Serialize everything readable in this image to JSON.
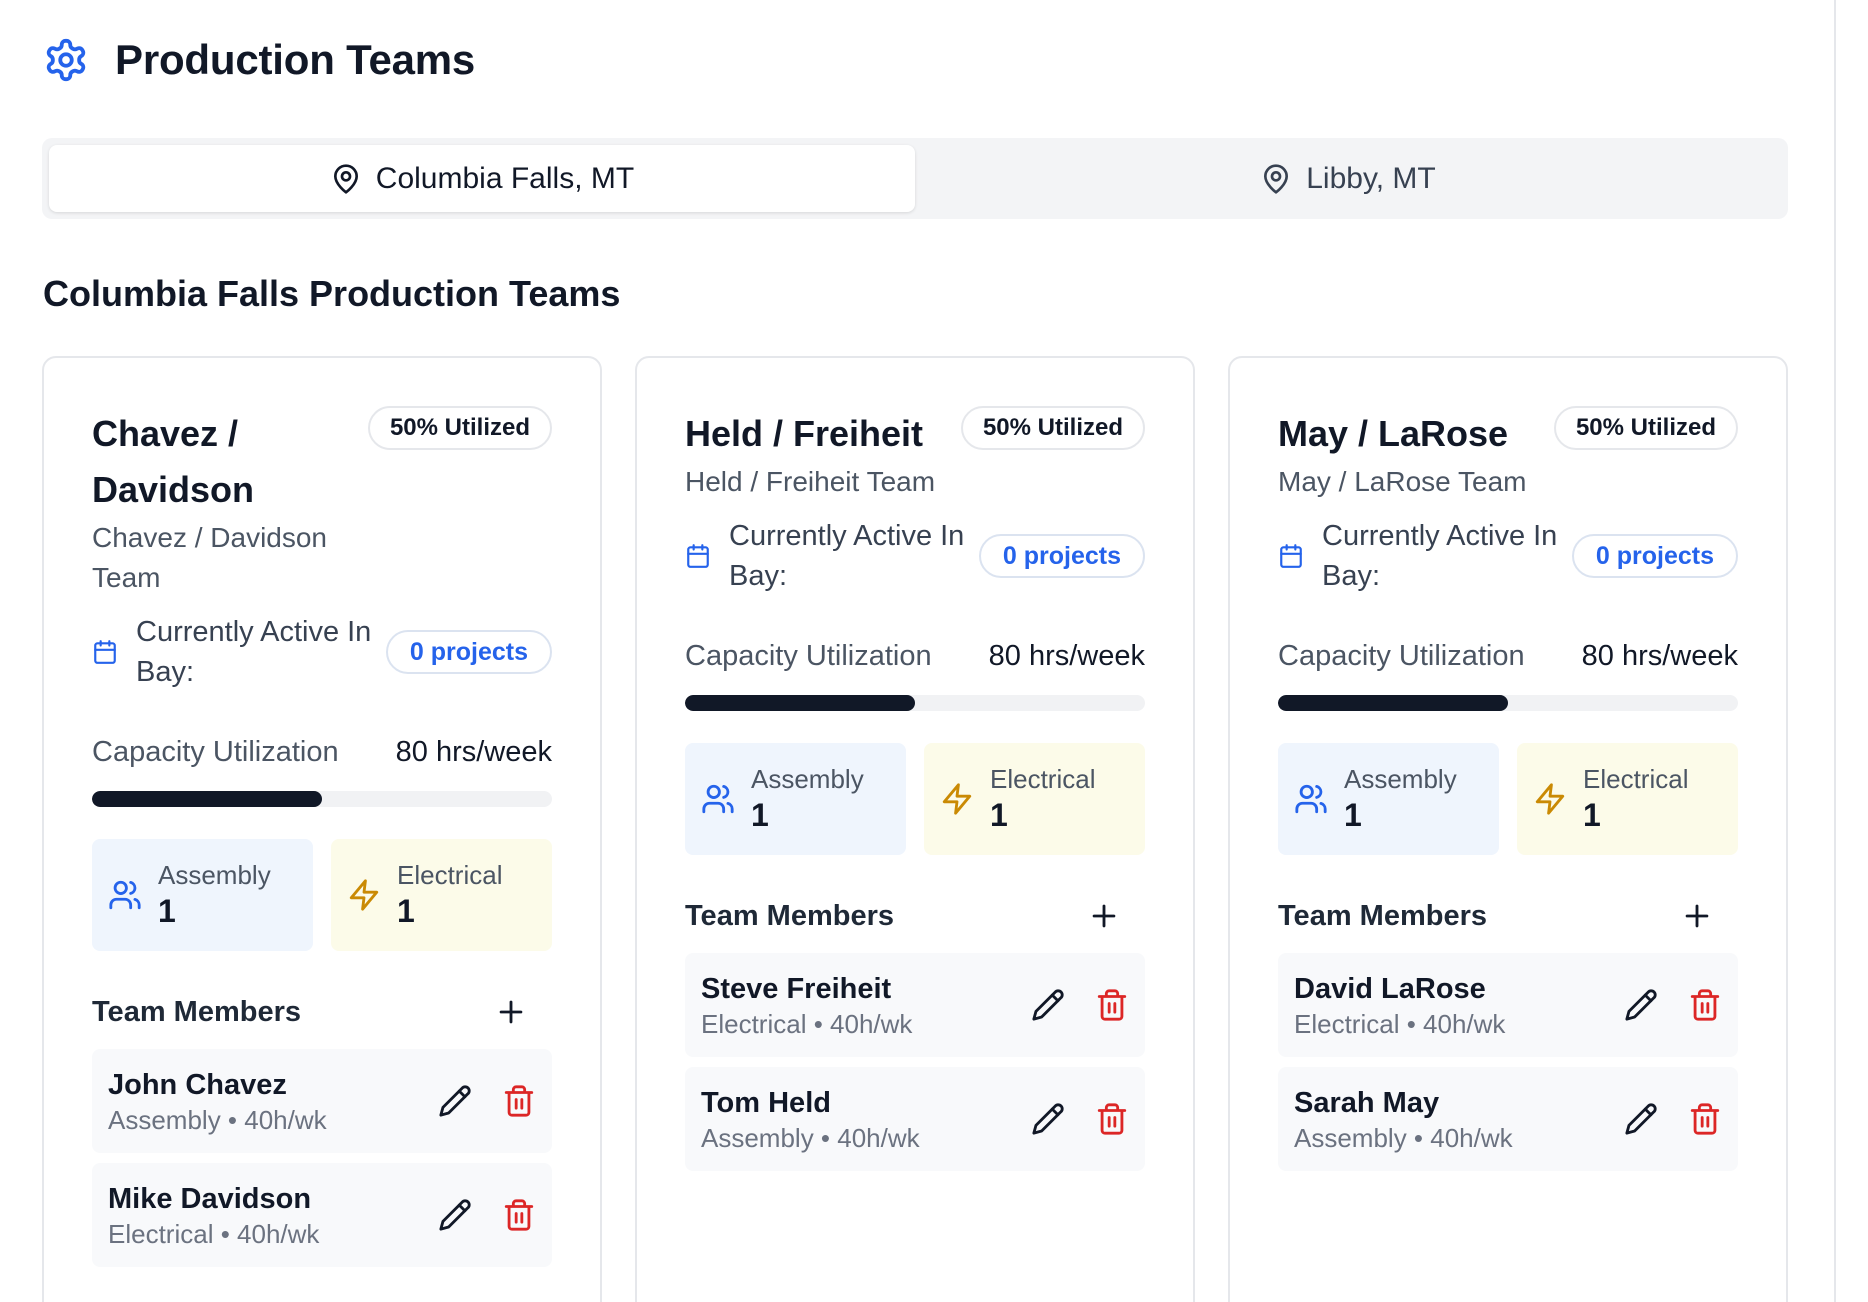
{
  "page": {
    "title": "Production Teams"
  },
  "tabs": [
    {
      "label": "Columbia Falls, MT",
      "active": true
    },
    {
      "label": "Libby, MT",
      "active": false
    }
  ],
  "section_title": "Columbia Falls Production Teams",
  "colors": {
    "accent": "#2563eb",
    "danger": "#dc2626",
    "bar": "#111827"
  },
  "cards": [
    {
      "title": "Chavez / Davidson",
      "subtitle": "Chavez / Davidson Team",
      "badge": "50% Utilized",
      "utilization": 0.5,
      "active_label": "Currently Active In Bay:",
      "projects": "0 projects",
      "capacity_label": "Capacity Utilization",
      "capacity_value": "80 hrs/week",
      "assembly_label": "Assembly",
      "assembly_value": "1",
      "electrical_label": "Electrical",
      "electrical_value": "1",
      "members_label": "Team Members",
      "members": [
        {
          "name": "John Chavez",
          "meta": "Assembly • 40h/wk"
        },
        {
          "name": "Mike Davidson",
          "meta": "Electrical • 40h/wk"
        }
      ]
    },
    {
      "title": "Held / Freiheit",
      "subtitle": "Held / Freiheit Team",
      "badge": "50% Utilized",
      "utilization": 0.5,
      "active_label": "Currently Active In Bay:",
      "projects": "0 projects",
      "capacity_label": "Capacity Utilization",
      "capacity_value": "80 hrs/week",
      "assembly_label": "Assembly",
      "assembly_value": "1",
      "electrical_label": "Electrical",
      "electrical_value": "1",
      "members_label": "Team Members",
      "members": [
        {
          "name": "Steve Freiheit",
          "meta": "Electrical • 40h/wk"
        },
        {
          "name": "Tom Held",
          "meta": "Assembly • 40h/wk"
        }
      ]
    },
    {
      "title": "May / LaRose",
      "subtitle": "May / LaRose Team",
      "badge": "50% Utilized",
      "utilization": 0.5,
      "active_label": "Currently Active In Bay:",
      "projects": "0 projects",
      "capacity_label": "Capacity Utilization",
      "capacity_value": "80 hrs/week",
      "assembly_label": "Assembly",
      "assembly_value": "1",
      "electrical_label": "Electrical",
      "electrical_value": "1",
      "members_label": "Team Members",
      "members": [
        {
          "name": "David LaRose",
          "meta": "Electrical • 40h/wk"
        },
        {
          "name": "Sarah May",
          "meta": "Assembly • 40h/wk"
        }
      ]
    }
  ]
}
